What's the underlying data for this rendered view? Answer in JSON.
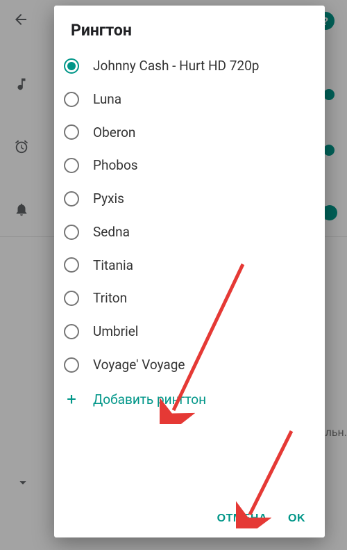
{
  "dialog": {
    "title": "Рингтон",
    "selected_index": 0,
    "options": [
      "Johnny Cash - Hurt HD 720p",
      "Luna",
      "Oberon",
      "Phobos",
      "Pyxis",
      "Sedna",
      "Titania",
      "Triton",
      "Umbriel",
      "Voyage' Voyage"
    ],
    "add_label": "Добавить рингтон",
    "cancel_label": "ОТМЕНА",
    "ok_label": "OK"
  },
  "background": {
    "help_glyph": "?",
    "partial_text_right": "дильн."
  }
}
